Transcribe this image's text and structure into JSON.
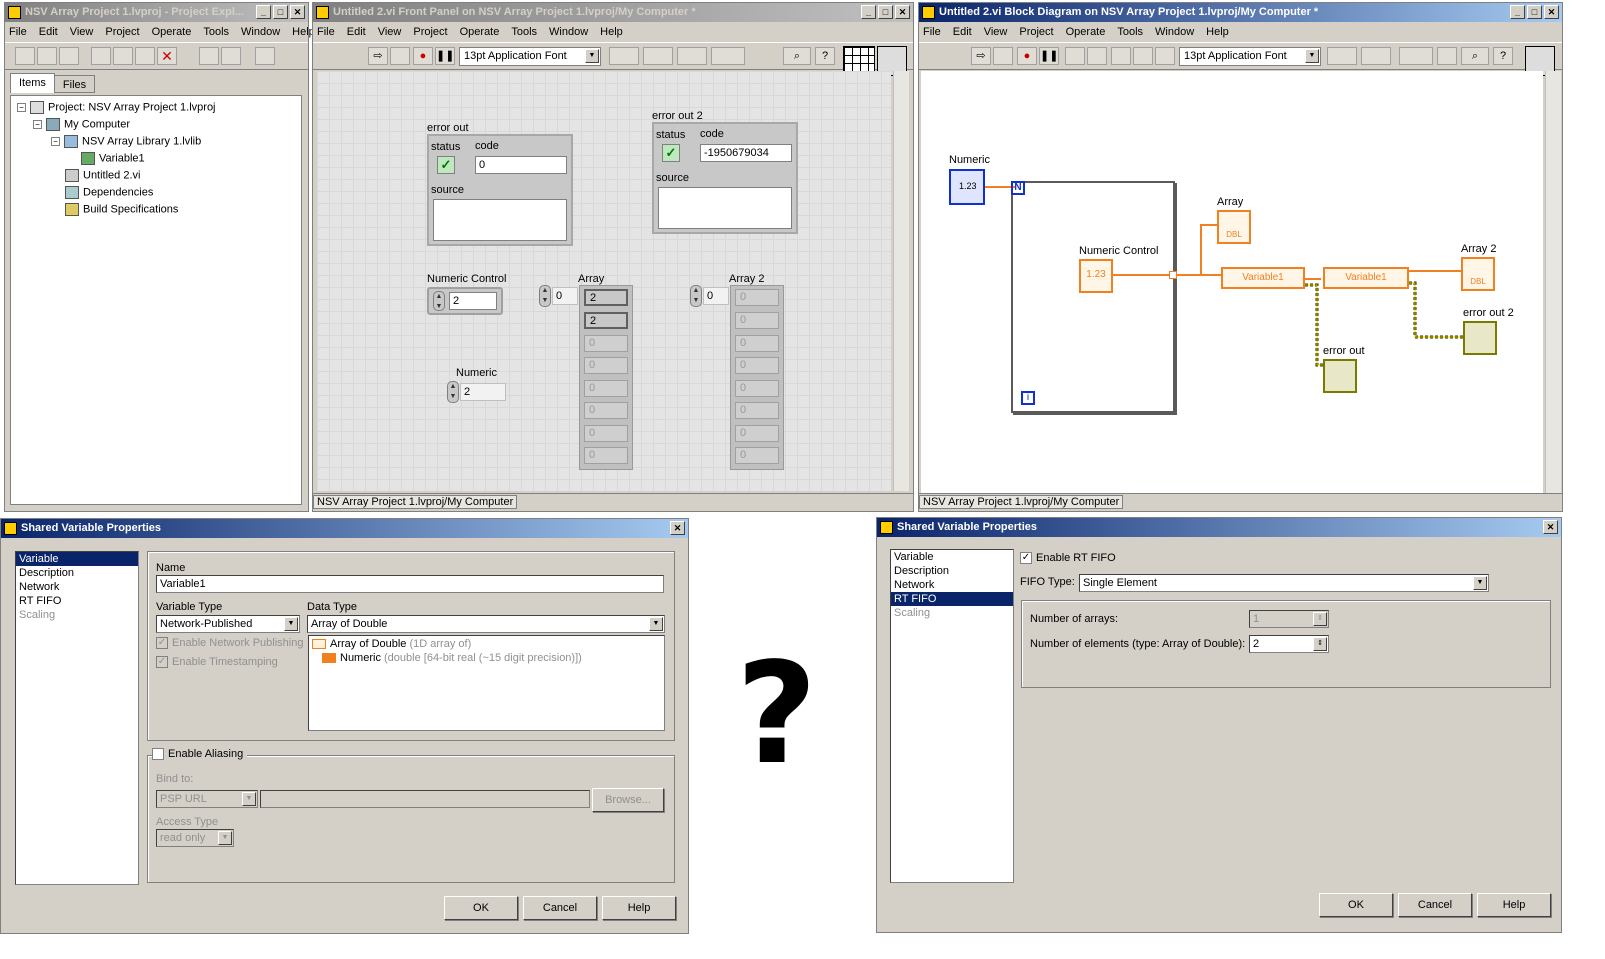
{
  "project_explorer": {
    "title": "NSV Array Project 1.lvproj - Project Expl...",
    "menu": [
      "File",
      "Edit",
      "View",
      "Project",
      "Operate",
      "Tools",
      "Window",
      "Help"
    ],
    "tabs": [
      "Items",
      "Files"
    ],
    "tree": [
      "Project: NSV Array Project 1.lvproj",
      "My Computer",
      "NSV Array Library 1.lvlib",
      "Variable1",
      "Untitled 2.vi",
      "Dependencies",
      "Build Specifications"
    ]
  },
  "front_panel": {
    "title": "Untitled 2.vi Front Panel on NSV Array Project 1.lvproj/My Computer *",
    "menu": [
      "File",
      "Edit",
      "View",
      "Project",
      "Operate",
      "Tools",
      "Window",
      "Help"
    ],
    "font": "13pt Application Font",
    "status": "NSV Array Project 1.lvproj/My Computer",
    "error_out": {
      "label": "error out",
      "status_label": "status",
      "code_label": "code",
      "code": "0",
      "source_label": "source"
    },
    "error_out2": {
      "label": "error out 2",
      "status_label": "status",
      "code_label": "code",
      "code": "-1950679034",
      "source_label": "source"
    },
    "numeric_control": {
      "label": "Numeric Control",
      "value": "2"
    },
    "numeric": {
      "label": "Numeric",
      "value": "2"
    },
    "array": {
      "label": "Array",
      "index": "0",
      "values": [
        "2",
        "2",
        "0",
        "0",
        "0",
        "0",
        "0",
        "0"
      ]
    },
    "array2": {
      "label": "Array 2",
      "index": "0",
      "values": [
        "0",
        "0",
        "0",
        "0",
        "0",
        "0",
        "0",
        "0"
      ]
    }
  },
  "block_diagram": {
    "title": "Untitled 2.vi Block Diagram on NSV Array Project 1.lvproj/My Computer *",
    "menu": [
      "File",
      "Edit",
      "View",
      "Project",
      "Operate",
      "Tools",
      "Window",
      "Help"
    ],
    "font": "13pt Application Font",
    "status": "NSV Array Project 1.lvproj/My Computer",
    "labels": {
      "numeric": "Numeric",
      "numeric_control": "Numeric Control",
      "array": "Array",
      "array2": "Array 2",
      "error_out": "error out",
      "error_out2": "error out 2",
      "var1": "Variable1",
      "var2": "Variable1",
      "n": "N",
      "i": "i",
      "num_term": "1.23",
      "dbl": "DBL"
    }
  },
  "svp_left": {
    "title": "Shared Variable Properties",
    "categories": [
      "Variable",
      "Description",
      "Network",
      "RT FIFO",
      "Scaling"
    ],
    "name_label": "Name",
    "name": "Variable1",
    "variable_type_label": "Variable Type",
    "variable_type": "Network-Published",
    "data_type_label": "Data Type",
    "data_type": "Array of Double",
    "enable_network_publishing": "Enable Network Publishing",
    "enable_timestamping": "Enable Timestamping",
    "type_tree": [
      {
        "name": "Array of Double",
        "detail": "(1D array of)"
      },
      {
        "name": "Numeric",
        "detail": "(double [64-bit real (~15 digit precision)])"
      }
    ],
    "enable_aliasing": "Enable Aliasing",
    "bind_to_label": "Bind to:",
    "bind_to": "PSP URL",
    "browse": "Browse...",
    "access_type_label": "Access Type",
    "access_type": "read only",
    "ok": "OK",
    "cancel": "Cancel",
    "help": "Help"
  },
  "question_mark": "?",
  "svp_right": {
    "title": "Shared Variable Properties",
    "categories": [
      "Variable",
      "Description",
      "Network",
      "RT FIFO",
      "Scaling"
    ],
    "enable_rt_fifo": "Enable RT FIFO",
    "fifo_type_label": "FIFO Type:",
    "fifo_type": "Single Element",
    "num_arrays_label": "Number of arrays:",
    "num_arrays": "1",
    "num_elements_label": "Number of elements (type: Array of Double):",
    "num_elements": "2",
    "ok": "OK",
    "cancel": "Cancel",
    "help": "Help"
  }
}
